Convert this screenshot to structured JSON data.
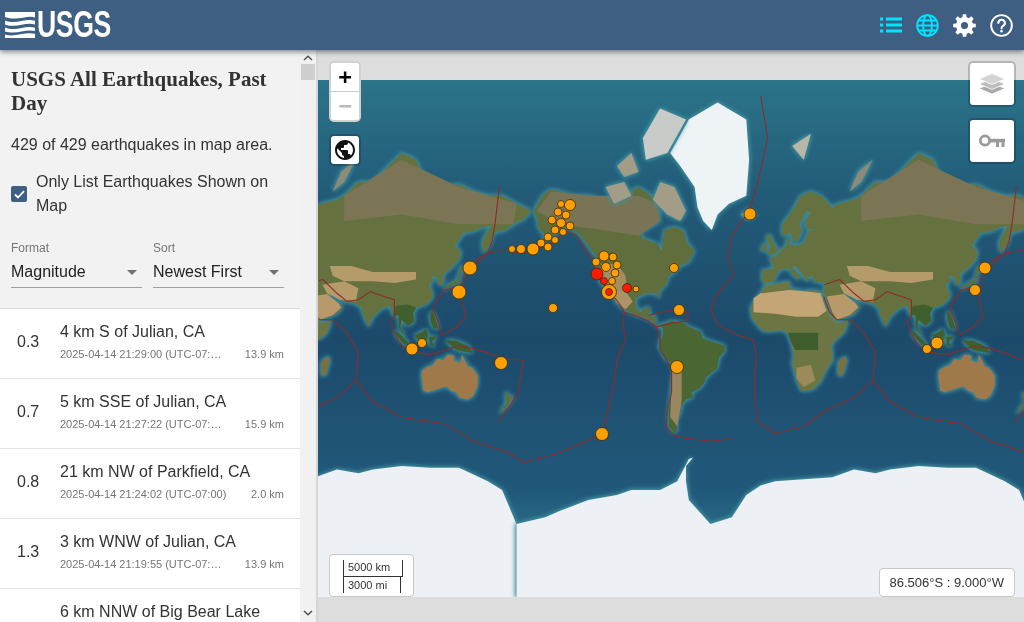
{
  "header": {
    "logo": "USGS",
    "nav": [
      {
        "kind": "list",
        "selected": true
      },
      {
        "kind": "map",
        "selected": true
      },
      {
        "kind": "settings",
        "selected": false
      },
      {
        "kind": "help",
        "selected": false
      }
    ]
  },
  "panel": {
    "title": "USGS All Earthquakes, Past Day",
    "summary": "429 of 429 earthquakes in map area.",
    "filter": {
      "label": "Only List Earthquakes Shown on Map",
      "checked": true
    },
    "selects": [
      {
        "label": "Format",
        "value": "Magnitude"
      },
      {
        "label": "Sort",
        "value": "Newest First"
      }
    ]
  },
  "earthquakes": [
    {
      "magnitude": "0.3",
      "place": "4 km S of Julian, CA",
      "time": "2025-04-14 21:29:00 (UTC-07:…",
      "depth": "13.9 km"
    },
    {
      "magnitude": "0.7",
      "place": "5 km SSE of Julian, CA",
      "time": "2025-04-14 21:27:22 (UTC-07:…",
      "depth": "15.9 km"
    },
    {
      "magnitude": "0.8",
      "place": "21 km NW of Parkfield, CA",
      "time": "2025-04-14 21:24:02 (UTC-07:00)",
      "depth": "2.0 km"
    },
    {
      "magnitude": "1.3",
      "place": "3 km WNW of Julian, CA",
      "time": "2025-04-14 21:19:55 (UTC-07:…",
      "depth": "13.9 km"
    },
    {
      "place": "6 km NNW of Big Bear Lake"
    }
  ],
  "map": {
    "zoom": [
      {
        "label": "+",
        "disabled": false
      },
      {
        "label": "−",
        "disabled": true
      }
    ],
    "scale": [
      "5000 km",
      "3000 mi"
    ],
    "coordinates": "86.506°S : 9.000°W"
  }
}
